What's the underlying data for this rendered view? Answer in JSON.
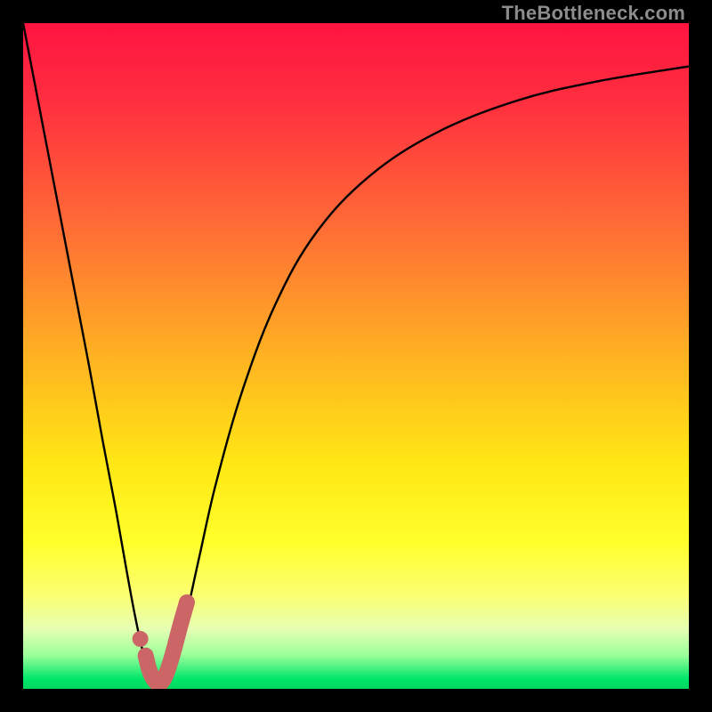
{
  "watermark": "TheBottleneck.com",
  "chart_data": {
    "type": "line",
    "title": "",
    "xlabel": "",
    "ylabel": "",
    "xlim": [
      0,
      100
    ],
    "ylim": [
      0,
      100
    ],
    "gradient_stops": [
      {
        "offset": 0.0,
        "color": "#ff1440"
      },
      {
        "offset": 0.12,
        "color": "#ff2f3f"
      },
      {
        "offset": 0.3,
        "color": "#ff6a36"
      },
      {
        "offset": 0.5,
        "color": "#ffb222"
      },
      {
        "offset": 0.66,
        "color": "#ffe714"
      },
      {
        "offset": 0.78,
        "color": "#ffff2b"
      },
      {
        "offset": 0.86,
        "color": "#fbff73"
      },
      {
        "offset": 0.91,
        "color": "#e6ffb3"
      },
      {
        "offset": 0.95,
        "color": "#99ff99"
      },
      {
        "offset": 0.985,
        "color": "#00e66a"
      },
      {
        "offset": 1.0,
        "color": "#00d85f"
      }
    ],
    "series": [
      {
        "name": "bottleneck-curve",
        "x": [
          0.0,
          2.5,
          5.0,
          7.5,
          10.0,
          12.0,
          14.0,
          15.5,
          16.8,
          18.0,
          19.0,
          20.3,
          21.5,
          23.0,
          24.5,
          26.5,
          29.0,
          33.0,
          38.0,
          44.0,
          52.0,
          62.0,
          74.0,
          86.0,
          100.0
        ],
        "y_pct": [
          100.0,
          87.0,
          74.0,
          61.0,
          48.0,
          37.0,
          26.5,
          18.0,
          11.0,
          5.5,
          2.0,
          0.5,
          2.0,
          5.5,
          11.0,
          20.0,
          31.0,
          45.0,
          58.0,
          68.5,
          77.0,
          83.5,
          88.3,
          91.2,
          93.5
        ]
      }
    ],
    "highlight": {
      "dot": {
        "x": 17.6,
        "y_pct": 7.5
      },
      "hook": [
        {
          "x": 18.4,
          "y_pct": 5.0
        },
        {
          "x": 19.0,
          "y_pct": 2.7
        },
        {
          "x": 19.7,
          "y_pct": 1.3
        },
        {
          "x": 20.5,
          "y_pct": 0.8
        },
        {
          "x": 21.4,
          "y_pct": 2.0
        },
        {
          "x": 22.4,
          "y_pct": 5.0
        },
        {
          "x": 23.6,
          "y_pct": 9.5
        },
        {
          "x": 24.6,
          "y_pct": 13.0
        }
      ],
      "color": "#cc6666"
    }
  }
}
